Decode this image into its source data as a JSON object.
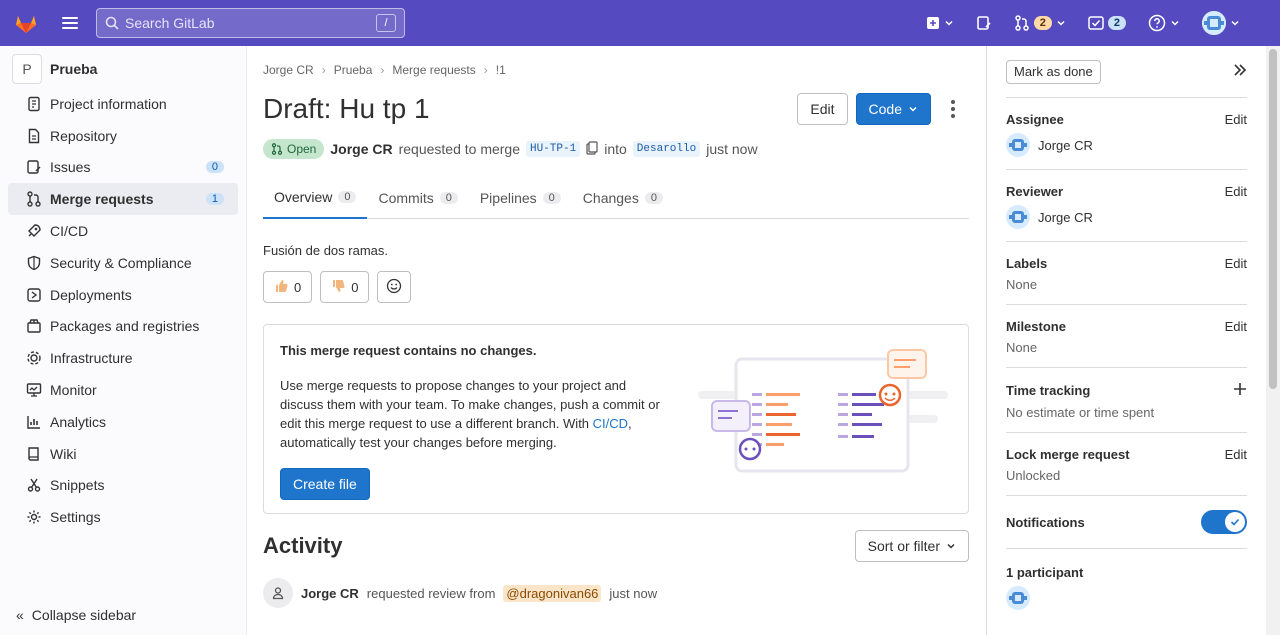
{
  "topbar": {
    "search_placeholder": "Search GitLab",
    "search_shortcut": "/",
    "mr_count": "2",
    "todo_count": "2"
  },
  "sidebar": {
    "project_initial": "P",
    "project_name": "Prueba",
    "items": [
      {
        "label": "Project information",
        "icon": "info-icon"
      },
      {
        "label": "Repository",
        "icon": "doc-icon"
      },
      {
        "label": "Issues",
        "icon": "issues-icon",
        "badge": "0"
      },
      {
        "label": "Merge requests",
        "icon": "merge-icon",
        "badge": "1"
      },
      {
        "label": "CI/CD",
        "icon": "rocket-icon"
      },
      {
        "label": "Security & Compliance",
        "icon": "shield-icon"
      },
      {
        "label": "Deployments",
        "icon": "deploy-icon"
      },
      {
        "label": "Packages and registries",
        "icon": "package-icon"
      },
      {
        "label": "Infrastructure",
        "icon": "cloud-gear-icon"
      },
      {
        "label": "Monitor",
        "icon": "monitor-icon"
      },
      {
        "label": "Analytics",
        "icon": "chart-icon"
      },
      {
        "label": "Wiki",
        "icon": "book-icon"
      },
      {
        "label": "Snippets",
        "icon": "scissors-icon"
      },
      {
        "label": "Settings",
        "icon": "gear-icon"
      }
    ],
    "collapse_label": "Collapse sidebar"
  },
  "breadcrumb": [
    "Jorge CR",
    "Prueba",
    "Merge requests",
    "!1"
  ],
  "mr": {
    "title": "Draft: Hu tp 1",
    "edit_label": "Edit",
    "code_label": "Code",
    "status": "Open",
    "author": "Jorge CR",
    "requested_text": "requested to merge",
    "source_branch": "HU-TP-1",
    "into_text": "into",
    "target_branch": "Desarollo",
    "time": "just now"
  },
  "tabs": [
    {
      "label": "Overview",
      "count": "0"
    },
    {
      "label": "Commits",
      "count": "0"
    },
    {
      "label": "Pipelines",
      "count": "0"
    },
    {
      "label": "Changes",
      "count": "0"
    }
  ],
  "description": "Fusión de dos ramas.",
  "reactions": {
    "thumbs_up": "0",
    "thumbs_down": "0"
  },
  "empty_state": {
    "title": "This merge request contains no changes.",
    "text_before_link": "Use merge requests to propose changes to your project and discuss them with your team. To make changes, push a commit or edit this merge request to use a different branch. With ",
    "link": "CI/CD",
    "text_after_link": ", automatically test your changes before merging.",
    "button": "Create file"
  },
  "activity": {
    "title": "Activity",
    "sort_label": "Sort or filter",
    "item_author": "Jorge CR",
    "item_text": "requested review from",
    "item_mention": "@dragonivan66",
    "item_time": "just now"
  },
  "right_sidebar": {
    "mark_done": "Mark as done",
    "assignee_label": "Assignee",
    "assignee_value": "Jorge CR",
    "reviewer_label": "Reviewer",
    "reviewer_value": "Jorge CR",
    "labels_label": "Labels",
    "labels_value": "None",
    "milestone_label": "Milestone",
    "milestone_value": "None",
    "time_label": "Time tracking",
    "time_value": "No estimate or time spent",
    "lock_label": "Lock merge request",
    "lock_value": "Unlocked",
    "notifications_label": "Notifications",
    "participants_label": "1 participant",
    "edit": "Edit"
  },
  "colors": {
    "navbar": "#554abf",
    "primary": "#1f75cb",
    "open_badge": "#c3e6cd"
  }
}
